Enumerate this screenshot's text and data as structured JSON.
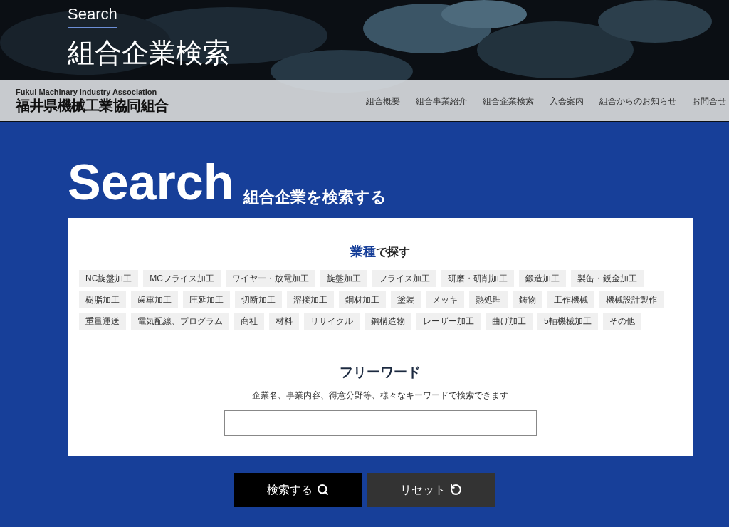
{
  "hero": {
    "eyebrow": "Search",
    "title": "組合企業検索"
  },
  "brand": {
    "subtitle": "Fukui Machinary Industry Association",
    "name": "福井県機械工業協同組合"
  },
  "nav": [
    "組合概要",
    "組合事業紹介",
    "組合企業検索",
    "入会案内",
    "組合からのお知らせ",
    "お問合せ"
  ],
  "section": {
    "title": "Search",
    "subtitle": "組合企業を検索する"
  },
  "categories": {
    "heading_accent": "業種",
    "heading_rest": "で探す",
    "tags": [
      "NC旋盤加工",
      "MCフライス加工",
      "ワイヤー・放電加工",
      "旋盤加工",
      "フライス加工",
      "研磨・研削加工",
      "鍛造加工",
      "製缶・鈑金加工",
      "樹脂加工",
      "歯車加工",
      "圧延加工",
      "切断加工",
      "溶接加工",
      "鋼材加工",
      "塗装",
      "メッキ",
      "熱処理",
      "鋳物",
      "工作機械",
      "機械設計製作",
      "重量運送",
      "電気配線、プログラム",
      "商社",
      "材料",
      "リサイクル",
      "鋼構造物",
      "レーザー加工",
      "曲げ加工",
      "5軸機械加工",
      "その他"
    ]
  },
  "freeword": {
    "title": "フリーワード",
    "description": "企業名、事業内容、得意分野等、様々なキーワードで検索できます"
  },
  "buttons": [
    {
      "kind": "search",
      "label": "検索する"
    },
    {
      "kind": "reset",
      "label": "リセット"
    }
  ]
}
